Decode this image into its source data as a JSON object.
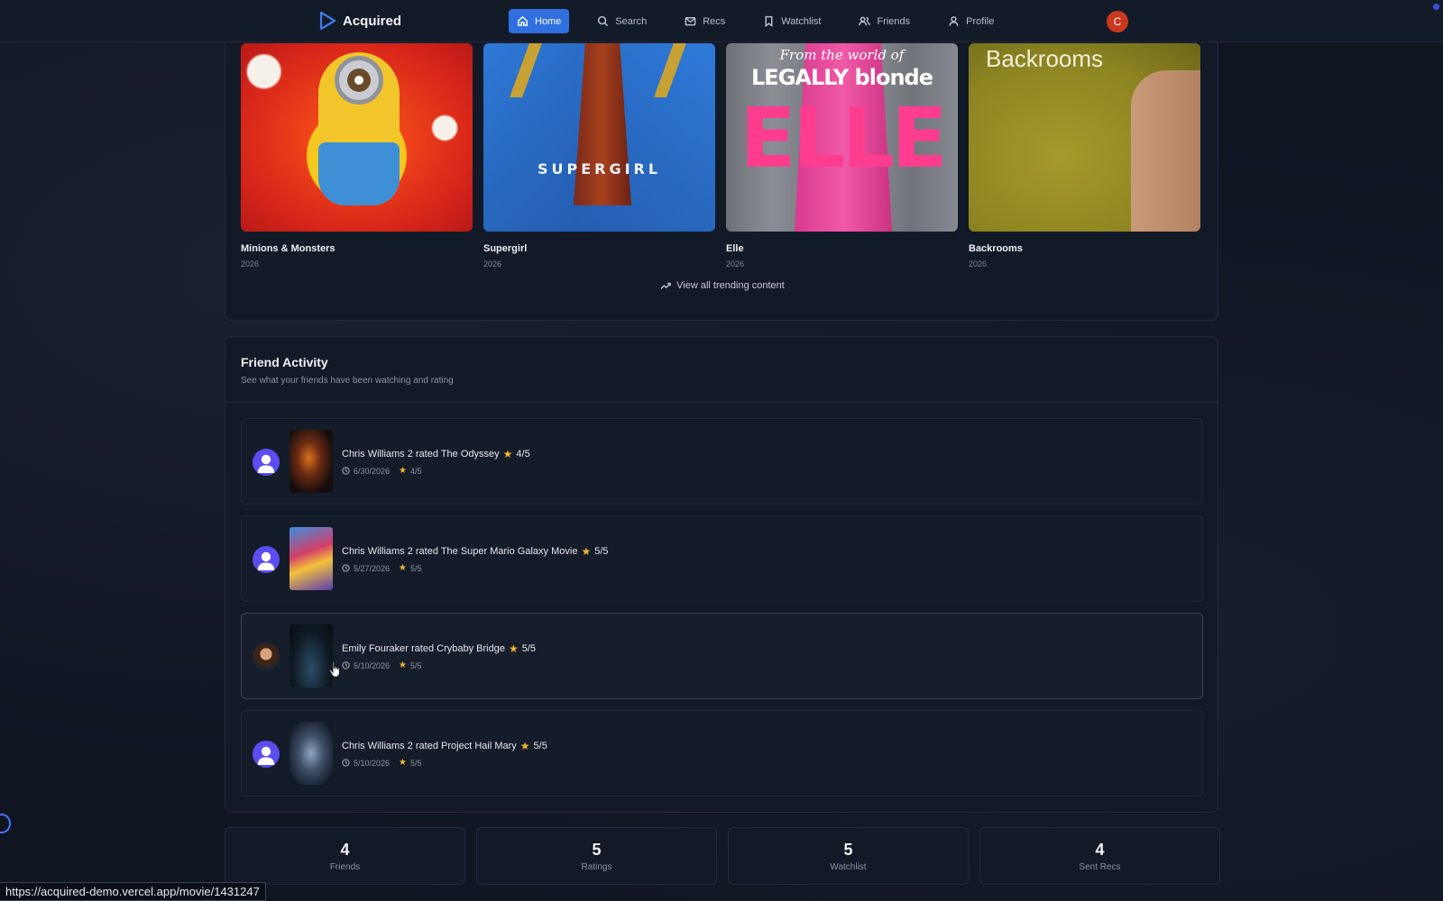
{
  "app": {
    "name": "Acquired",
    "user_initial": "C",
    "accent_color": "#2f6fe0"
  },
  "nav": {
    "items": [
      {
        "label": "Home",
        "icon": "home-icon",
        "active": true
      },
      {
        "label": "Search",
        "icon": "search-icon",
        "active": false
      },
      {
        "label": "Recs",
        "icon": "mail-icon",
        "active": false
      },
      {
        "label": "Watchlist",
        "icon": "bookmark-icon",
        "active": false
      },
      {
        "label": "Friends",
        "icon": "users-icon",
        "active": false
      },
      {
        "label": "Profile",
        "icon": "user-icon",
        "active": false
      }
    ]
  },
  "trending": {
    "items": [
      {
        "title": "Minions & Monsters",
        "year": "2026"
      },
      {
        "title": "Supergirl",
        "year": "2026",
        "poster_text": "SUPERGIRL"
      },
      {
        "title": "Elle",
        "year": "2026",
        "poster_text_top": "From the world of",
        "poster_text_mid": "LEGALLY blonde",
        "poster_text_big": "ELLE"
      },
      {
        "title": "Backrooms",
        "year": "2026",
        "poster_text": "Backrooms"
      }
    ],
    "view_all_label": "View all trending content"
  },
  "friend_activity": {
    "title": "Friend Activity",
    "subtitle": "See what your friends have been watching and rating",
    "items": [
      {
        "user": "Chris Williams 2",
        "headline": "Chris Williams 2 rated The Odyssey",
        "rating": "4/5",
        "date": "6/30/2026",
        "meta_rating": "4/5"
      },
      {
        "user": "Chris Williams 2",
        "headline": "Chris Williams 2 rated The Super Mario Galaxy Movie",
        "rating": "5/5",
        "date": "5/27/2026",
        "meta_rating": "5/5"
      },
      {
        "user": "Emily Fouraker",
        "headline": "Emily Fouraker rated Crybaby Bridge",
        "rating": "5/5",
        "date": "5/10/2026",
        "meta_rating": "5/5"
      },
      {
        "user": "Chris Williams 2",
        "headline": "Chris Williams 2 rated Project Hail Mary",
        "rating": "5/5",
        "date": "5/10/2026",
        "meta_rating": "5/5"
      }
    ]
  },
  "stats": [
    {
      "value": "4",
      "label": "Friends"
    },
    {
      "value": "5",
      "label": "Ratings"
    },
    {
      "value": "5",
      "label": "Watchlist"
    },
    {
      "value": "4",
      "label": "Sent Recs"
    }
  ],
  "status_bar": {
    "url": "https://acquired-demo.vercel.app/movie/1431247"
  }
}
